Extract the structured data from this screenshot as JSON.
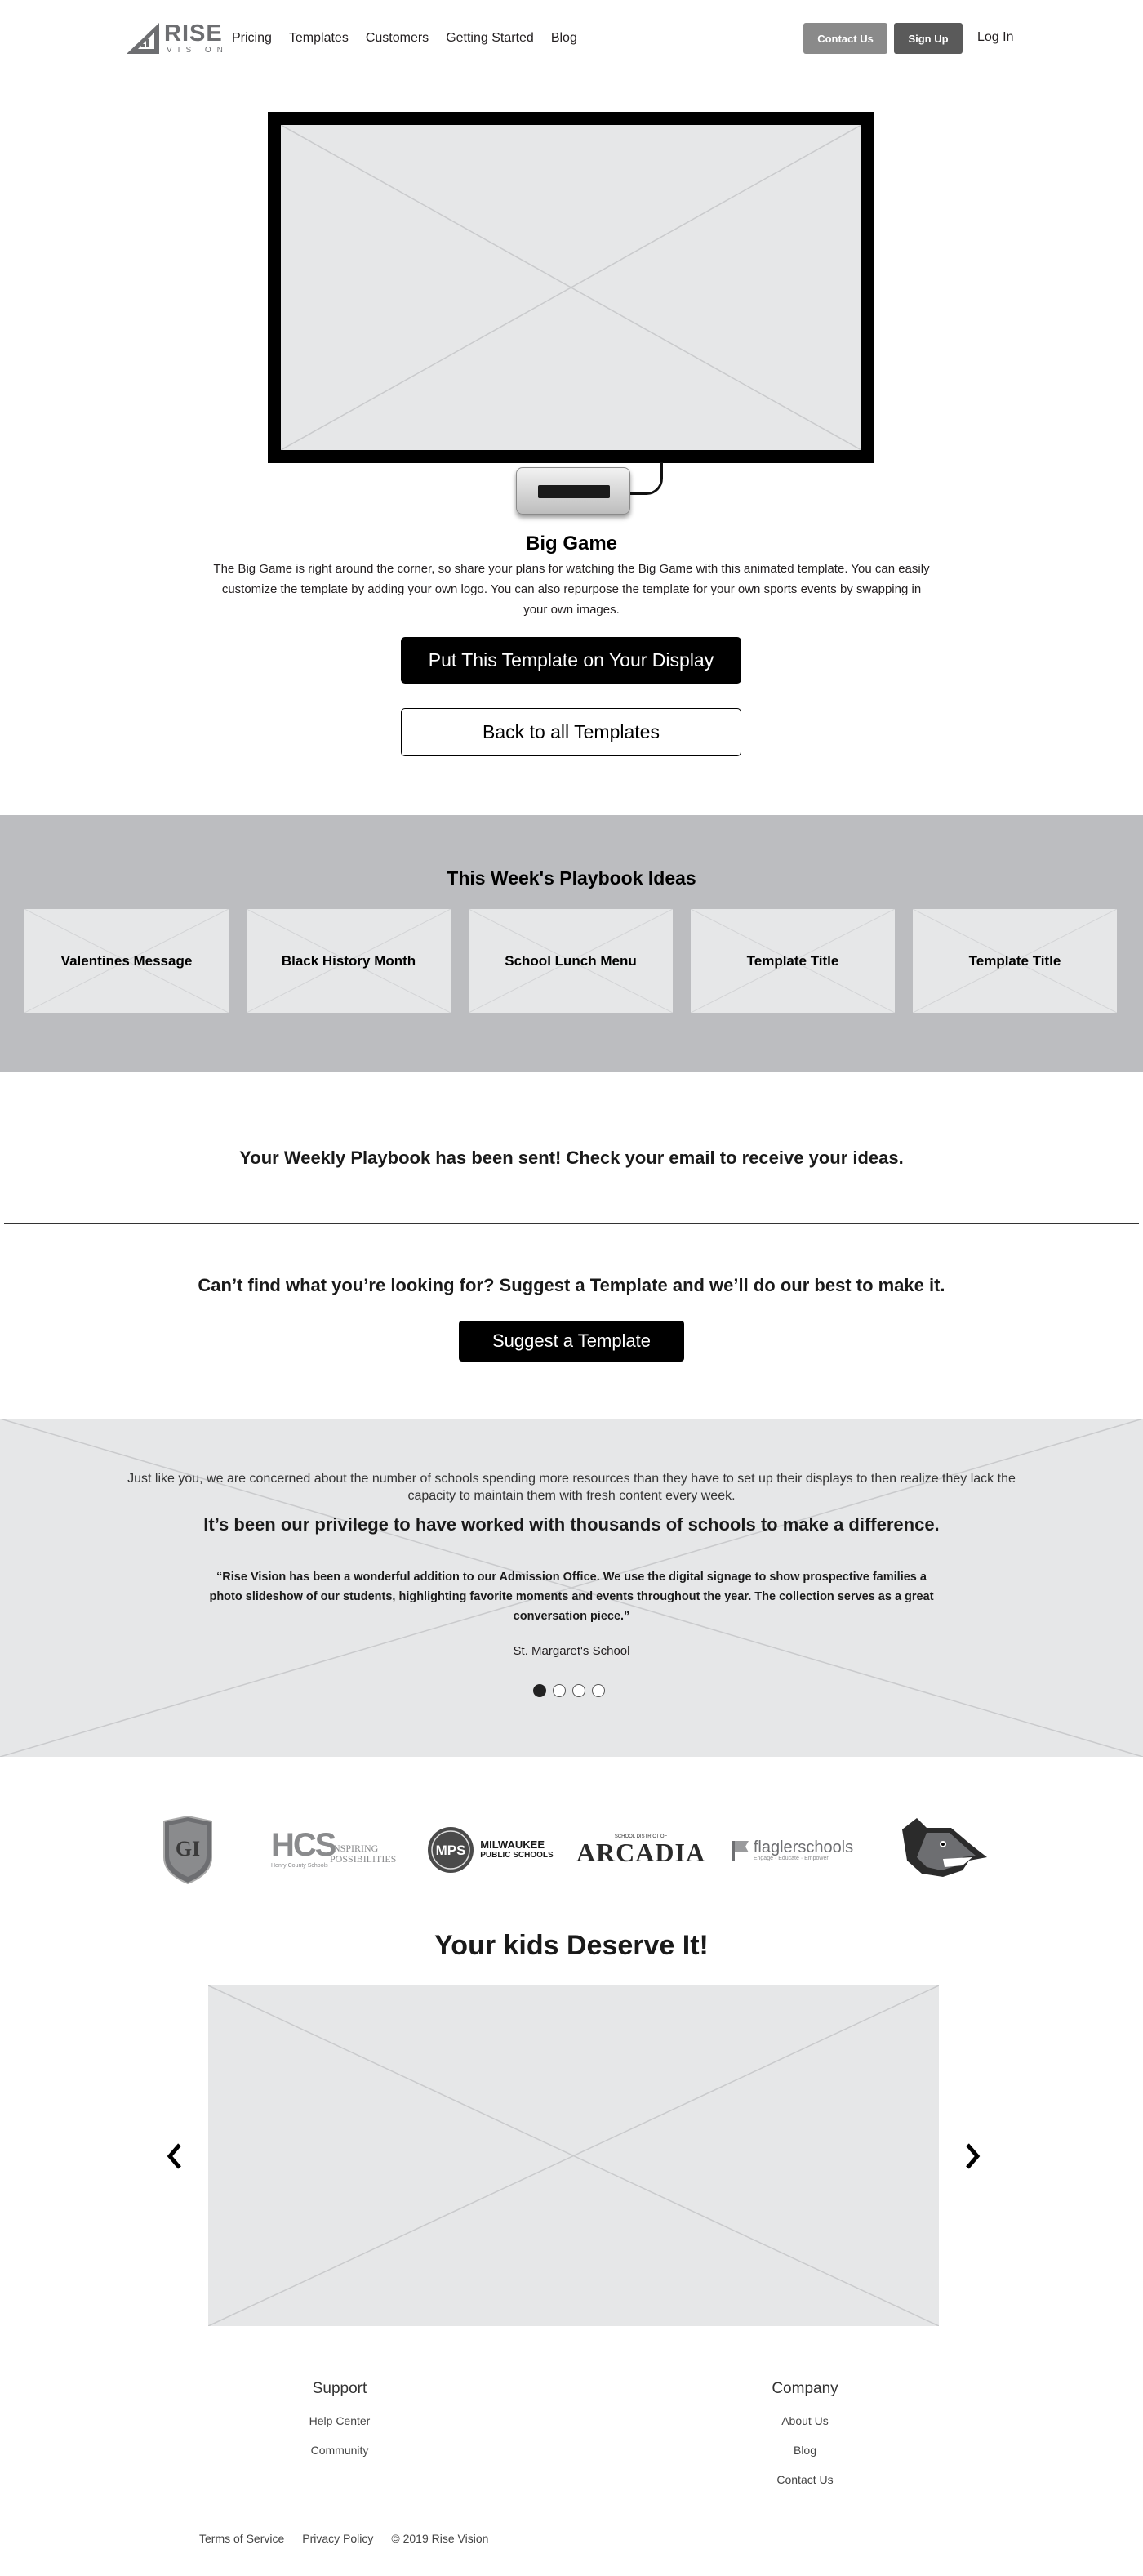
{
  "header": {
    "logo_text": "RISE",
    "logo_sub": "VISION",
    "nav": [
      "Pricing",
      "Templates",
      "Customers",
      "Getting Started",
      "Blog"
    ],
    "contact_label": "Contact Us",
    "signup_label": "Sign Up",
    "login_label": "Log In"
  },
  "template": {
    "title": "Big Game",
    "description": "The Big Game is right around the corner, so share your plans for watching the Big Game with this animated template. You can easily customize the template by adding your own logo. You can also repurpose the template for your own sports events by swapping in your own images.",
    "primary_button": "Put This Template on Your Display",
    "back_button": "Back to all Templates"
  },
  "playbook": {
    "title": "This Week's Playbook Ideas",
    "cards": [
      "Valentines Message",
      "Black History Month",
      "School Lunch Menu",
      "Template Title",
      "Template Title"
    ]
  },
  "sent_message": "Your Weekly Playbook has been sent! Check your email to receive your ideas.",
  "suggest": {
    "heading": "Can’t find what you’re looking for? Suggest a Template and we’ll do our best to make it.",
    "button": "Suggest a Template"
  },
  "testimonial": {
    "intro": "Just like you, we are concerned about the number of schools spending more resources than they have to set up their displays to then realize they lack the capacity to maintain them with fresh content every week.",
    "heading": "It’s been our privilege to have worked with thousands of schools to make a difference.",
    "quote": "“Rise Vision has been a wonderful addition to our Admission Office. We use the digital signage to show prospective families a photo slideshow of our students, highlighting favorite moments and events throughout the year. The collection serves as a great conversation piece.”",
    "author": "St. Margaret's School",
    "active_slide": 1,
    "slide_count": 4
  },
  "logos": {
    "gi": "GI",
    "hcs": "HCS",
    "hcs_tag": "INSPIRING POSSIBILITIES",
    "hcs_sub": "Henry County Schools",
    "mps": "MPS",
    "mps_name_1": "MILWAUKEE",
    "mps_name_2": "PUBLIC SCHOOLS",
    "arcadia_top": "SCHOOL DISTRICT OF",
    "arcadia": "ARCADIA",
    "flagler": "flaglerschools",
    "flagler_sub": "Engage · Educate · Empower"
  },
  "kids": {
    "title": "Your kids Deserve It!"
  },
  "footer": {
    "support_heading": "Support",
    "support_links": [
      "Help Center",
      "Community"
    ],
    "company_heading": "Company",
    "company_links": [
      "About Us",
      "Blog",
      "Contact Us"
    ],
    "terms": "Terms of Service",
    "privacy": "Privacy Policy",
    "copyright": "© 2019 Rise Vision"
  },
  "colors": {
    "placeholder": "#e6e7e8",
    "playbook_bg": "#bcbdc0",
    "primary": "#000000",
    "contact_button": "#8a8a8a",
    "signup_button": "#5a5a5a"
  }
}
